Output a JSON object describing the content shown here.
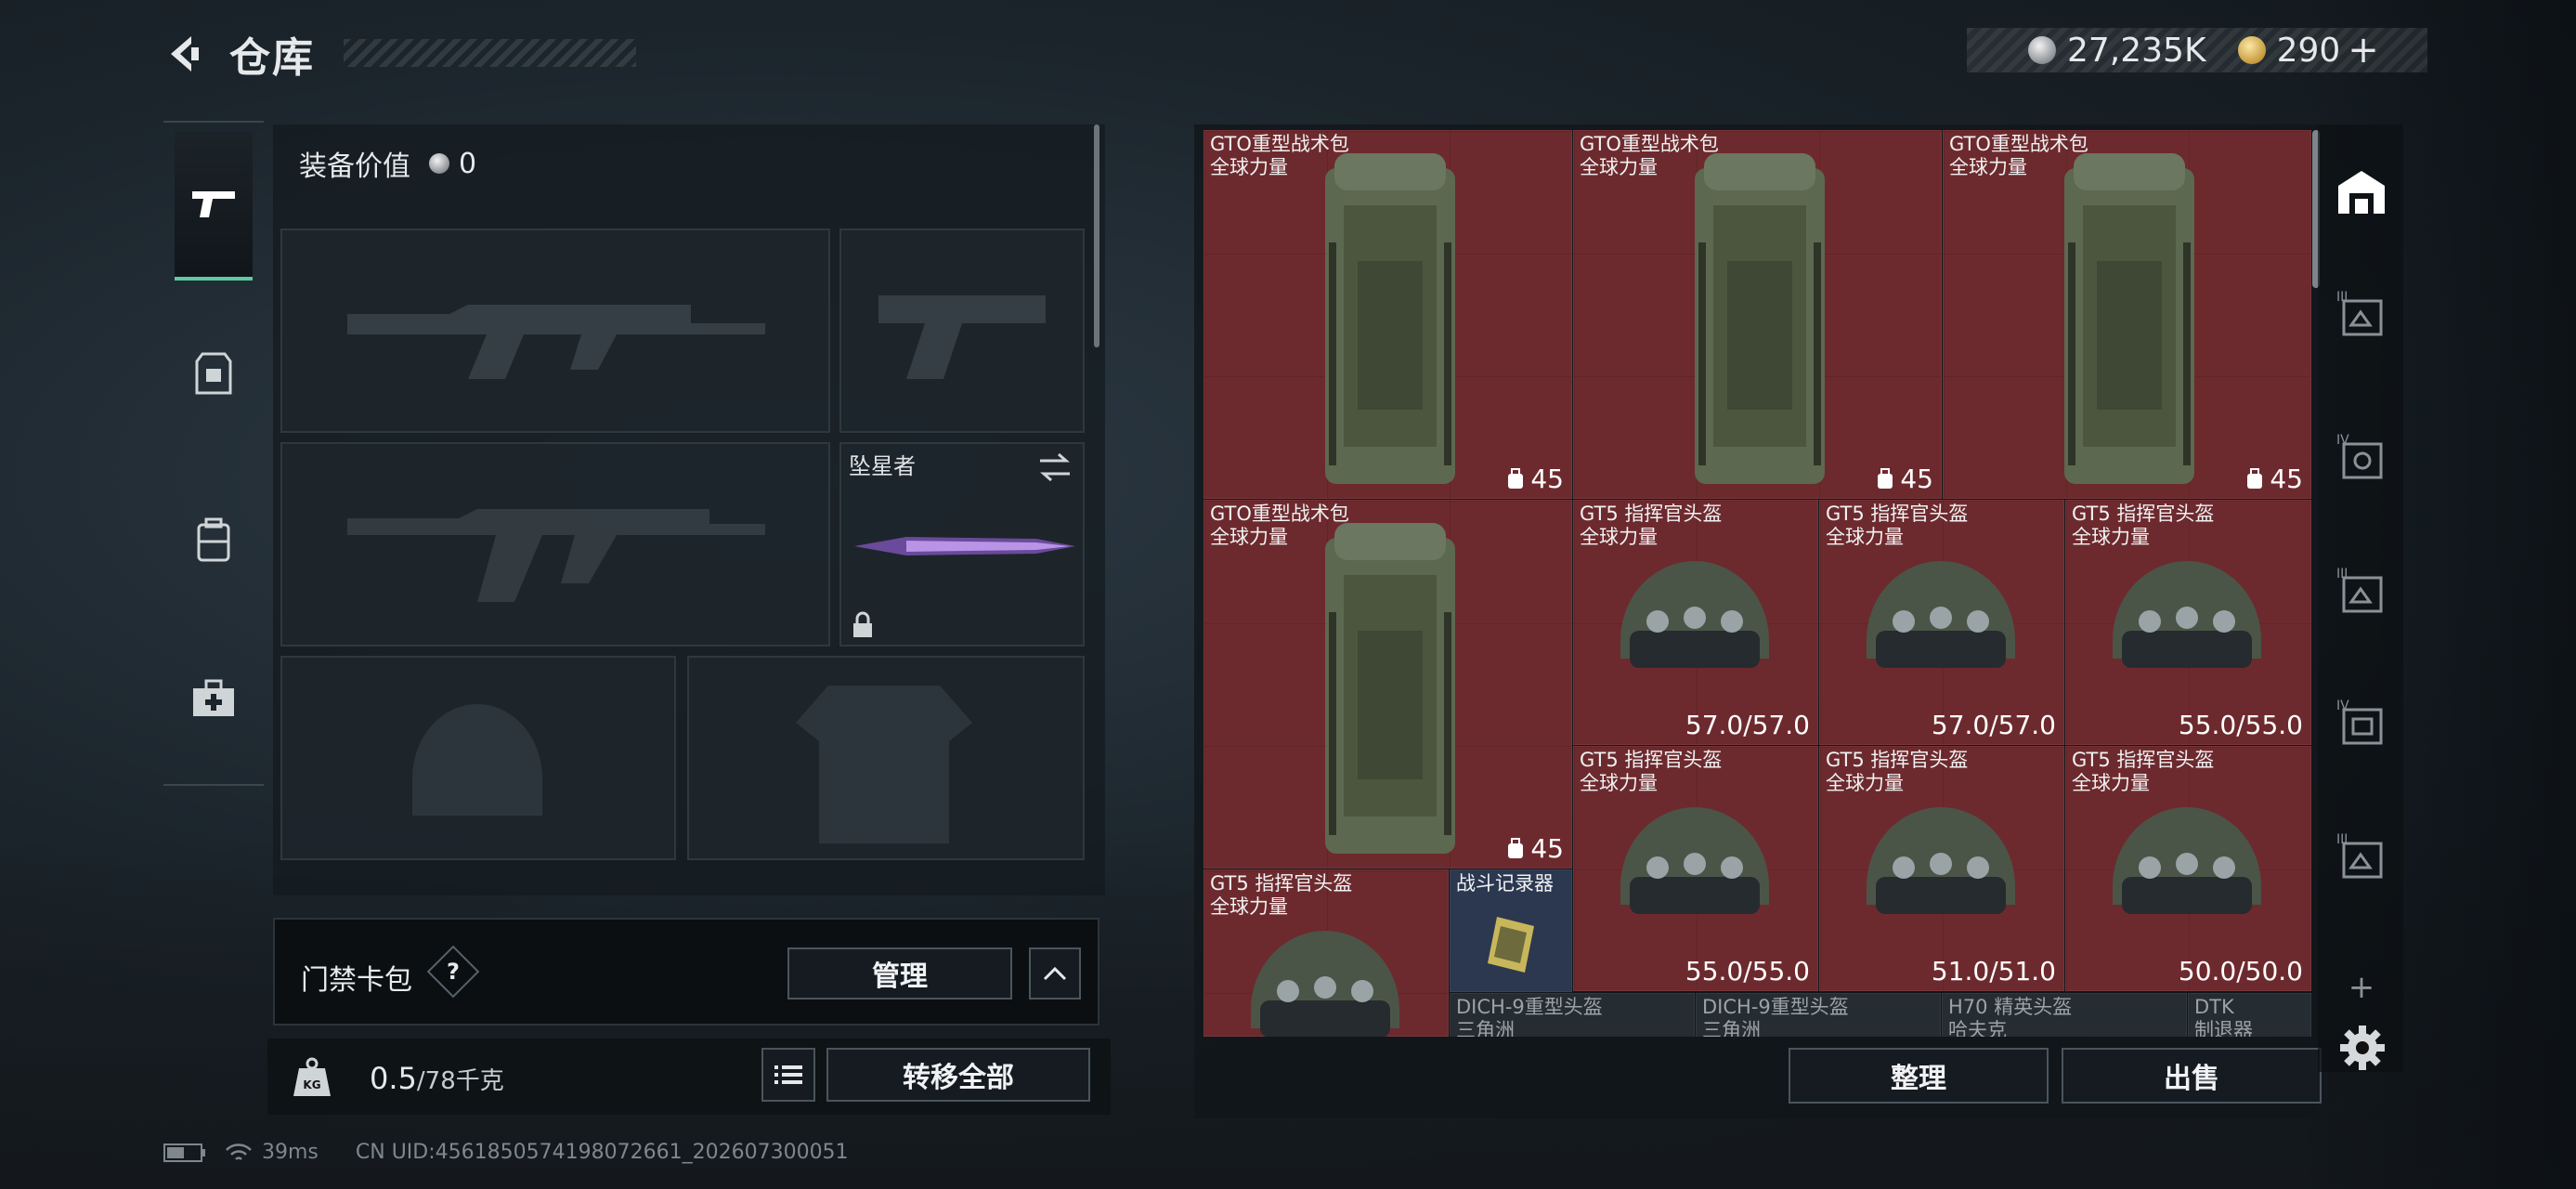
{
  "header": {
    "title": "仓库",
    "silver_amount": "27,235K",
    "gold_amount": "290",
    "gold_plus": "+"
  },
  "equipment": {
    "value_label": "装备价值",
    "value_amount": "0",
    "melee_label": "坠星者"
  },
  "access": {
    "label": "门禁卡包",
    "help": "?",
    "manage_button": "管理"
  },
  "weight": {
    "current": "0.5",
    "max": "/78千克",
    "icon_text": "KG"
  },
  "actions": {
    "transfer_all": "转移全部",
    "sort": "整理",
    "sell": "出售"
  },
  "status": {
    "ping": "39ms",
    "uid": "CN UID:4561850574198072661_202607300051"
  },
  "inventory": {
    "backpacks": [
      {
        "name": "GTO重型战术包",
        "sub": "全球力量",
        "count": "45"
      },
      {
        "name": "GTO重型战术包",
        "sub": "全球力量",
        "count": "45"
      },
      {
        "name": "GTO重型战术包",
        "sub": "全球力量",
        "count": "45"
      },
      {
        "name": "GTO重型战术包",
        "sub": "全球力量",
        "count": "45"
      }
    ],
    "helmets": [
      {
        "name": "GT5 指挥官头盔",
        "sub": "全球力量",
        "durability": "57.0/57.0"
      },
      {
        "name": "GT5 指挥官头盔",
        "sub": "全球力量",
        "durability": "57.0/57.0"
      },
      {
        "name": "GT5 指挥官头盔",
        "sub": "全球力量",
        "durability": "55.0/55.0"
      },
      {
        "name": "GT5 指挥官头盔",
        "sub": "全球力量",
        "durability": "55.0/55.0"
      },
      {
        "name": "GT5 指挥官头盔",
        "sub": "全球力量",
        "durability": "51.0/51.0"
      },
      {
        "name": "GT5 指挥官头盔",
        "sub": "全球力量",
        "durability": "50.0/50.0"
      },
      {
        "name": "GT5 指挥官头盔",
        "sub": "全球力量",
        "durability": ""
      }
    ],
    "recorder": {
      "name": "战斗记录器"
    },
    "bottom_row": [
      {
        "name": "DICH-9重型头盔",
        "sub": "三角洲"
      },
      {
        "name": "DICH-9重型头盔",
        "sub": "三角洲"
      },
      {
        "name": "H70 精英头盔",
        "sub": "哈夫克"
      },
      {
        "name": "DTK",
        "sub": "制退器"
      }
    ]
  },
  "filters": {
    "labels": [
      "III",
      "IV",
      "III",
      "IV",
      "III"
    ],
    "plus": "+"
  },
  "colors": {
    "accent": "#5fc9a4",
    "item_highlight": "#6d2a2e"
  }
}
